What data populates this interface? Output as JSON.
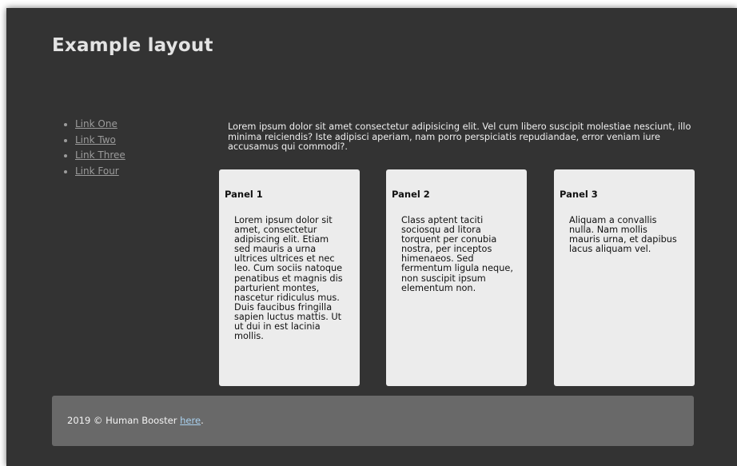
{
  "header": {
    "title": "Example layout"
  },
  "nav": {
    "links": [
      "Link One",
      "Link Two",
      "Link Three",
      "Link Four"
    ]
  },
  "intro": {
    "text": "Lorem ipsum dolor sit amet consectetur adipisicing elit. Vel cum libero suscipit molestiae nesciunt, illo minima reiciendis? Iste adipisci aperiam, nam porro perspiciatis repudiandae, error veniam iure accusamus qui commodi?."
  },
  "panels": [
    {
      "title": "Panel 1",
      "body": "Lorem ipsum dolor sit amet, consectetur adipiscing elit. Etiam sed mauris a urna ultrices ultrices et nec leo. Cum sociis natoque penatibus et magnis dis parturient montes, nascetur ridiculus mus. Duis faucibus fringilla sapien luctus mattis. Ut ut dui in est lacinia mollis."
    },
    {
      "title": "Panel 2",
      "body": "Class aptent taciti sociosqu ad litora torquent per conubia nostra, per inceptos himenaeos. Sed fermentum ligula neque, non suscipit ipsum elementum non."
    },
    {
      "title": "Panel 3",
      "body": "Aliquam a convallis nulla. Nam mollis mauris urna, et dapibus lacus aliquam vel."
    }
  ],
  "footer": {
    "text": "2019 © Human Booster ",
    "link_label": "here",
    "suffix": "."
  },
  "colors": {
    "page_background": "#333333",
    "panel_background": "#ececec",
    "footer_background": "#696969",
    "nav_link": "#9b9b9b",
    "footer_link": "#a9d1ef"
  }
}
